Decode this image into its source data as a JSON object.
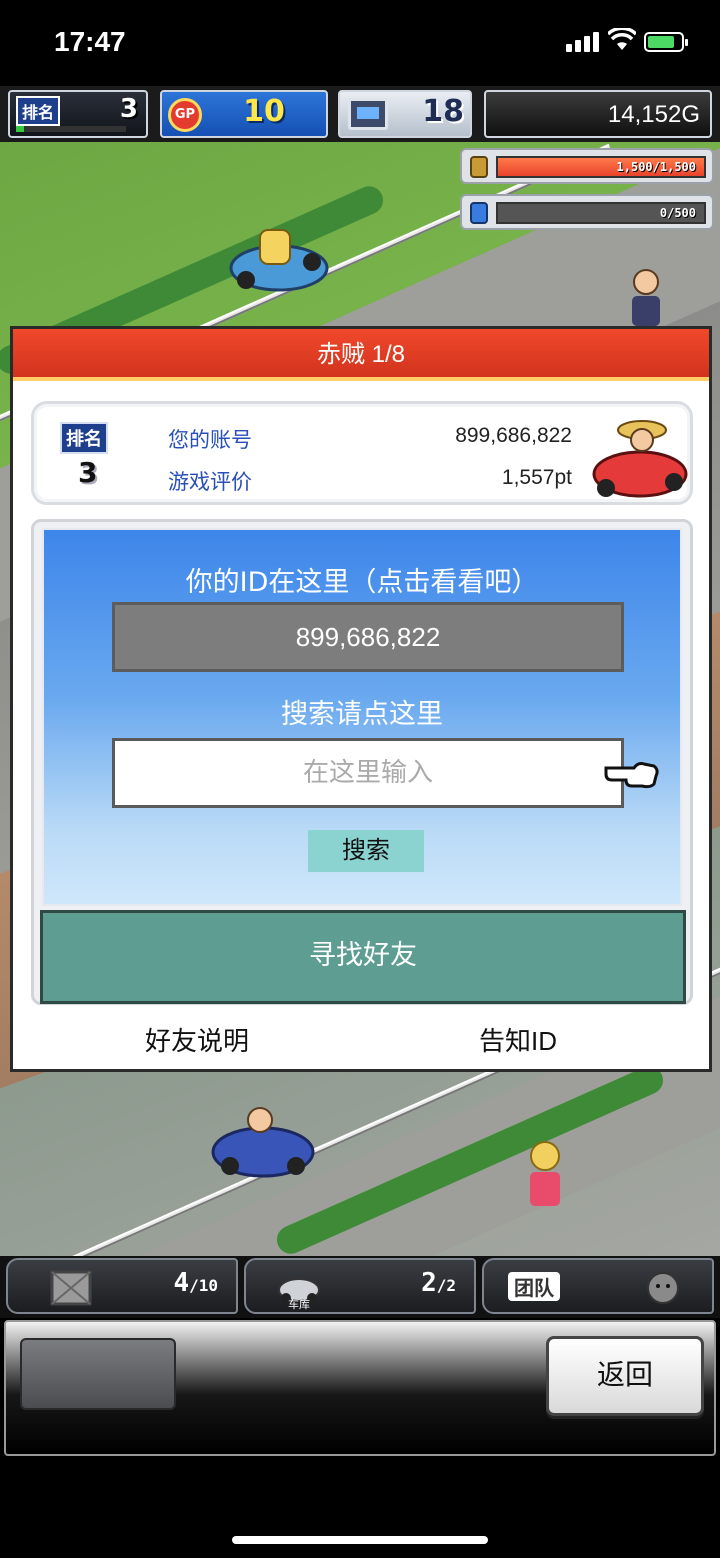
{
  "status_bar": {
    "time": "17:47"
  },
  "hud": {
    "rank_label": "排名",
    "rank_value": "3",
    "gp_label": "GP",
    "gp_value": "10",
    "pc_value": "18",
    "money": "14,152G"
  },
  "resources": [
    {
      "icon": "fuel-can-icon",
      "text": "1,500/1,500",
      "fill_fraction": 1.0,
      "color": "#e8432b"
    },
    {
      "icon": "potion-icon",
      "text": "0/500",
      "fill_fraction": 0.0,
      "color": "#3a7be0"
    }
  ],
  "dialog": {
    "title": "赤贼 1/8",
    "profile": {
      "rank_label": "排名",
      "rank_value": "3",
      "account_label": "您的账号",
      "account_value": "899,686,822",
      "rating_label": "游戏评价",
      "rating_value": "1,557pt"
    },
    "id_heading": "你的ID在这里（点击看看吧）",
    "id_value": "899,686,822",
    "search_heading": "搜索请点这里",
    "search_placeholder": "在这里输入",
    "search_button": "搜索",
    "find_friends_button": "寻找好友",
    "friend_help_link": "好友说明",
    "share_id_link": "告知ID"
  },
  "bottom": {
    "slot1_count": "4",
    "slot1_total": "10",
    "slot2_label": "车库",
    "slot2_count": "2",
    "slot2_total": "2",
    "slot3_label": "团队",
    "back_button": "返回"
  },
  "colors": {
    "title_red": "#e43f24",
    "find_button_teal": "#5e9e92",
    "search_button_cyan": "#8bd3d0"
  }
}
